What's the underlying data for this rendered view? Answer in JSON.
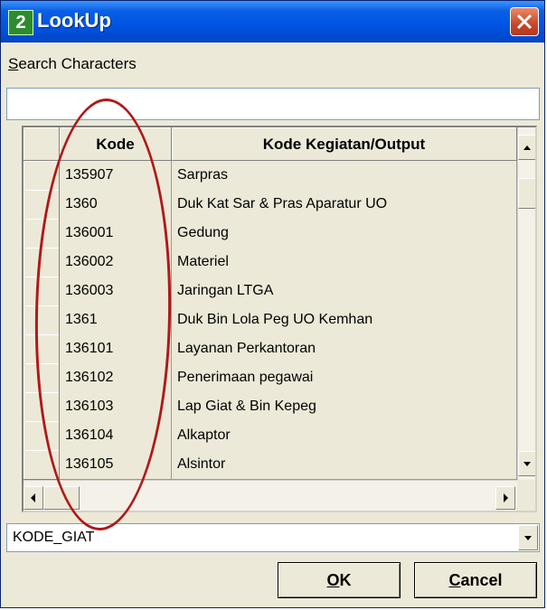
{
  "window": {
    "title": "LookUp",
    "icon_label": "2"
  },
  "search": {
    "label": "Search Characters",
    "value": "",
    "placeholder": ""
  },
  "grid": {
    "columns": [
      "Kode",
      "Kode Kegiatan/Output"
    ],
    "rows": [
      [
        "135907",
        "Sarpras"
      ],
      [
        "1360",
        "Duk Kat Sar & Pras Aparatur UO"
      ],
      [
        "136001",
        "Gedung"
      ],
      [
        "136002",
        "Materiel"
      ],
      [
        "136003",
        "Jaringan LTGA"
      ],
      [
        "1361",
        "Duk Bin Lola Peg UO Kemhan"
      ],
      [
        "136101",
        "Layanan Perkantoran"
      ],
      [
        "136102",
        "Penerimaan pegawai"
      ],
      [
        "136103",
        "Lap Giat & Bin Kepeg"
      ],
      [
        "136104",
        "Alkaptor"
      ],
      [
        "136105",
        "Alsintor"
      ]
    ]
  },
  "field_combo": {
    "value": "KODE_GIAT"
  },
  "buttons": {
    "ok": "OK",
    "cancel": "Cancel"
  },
  "colors": {
    "annotation": "#B01818",
    "titlebar": "#0054E3",
    "window_bg": "#ECE9D8"
  }
}
